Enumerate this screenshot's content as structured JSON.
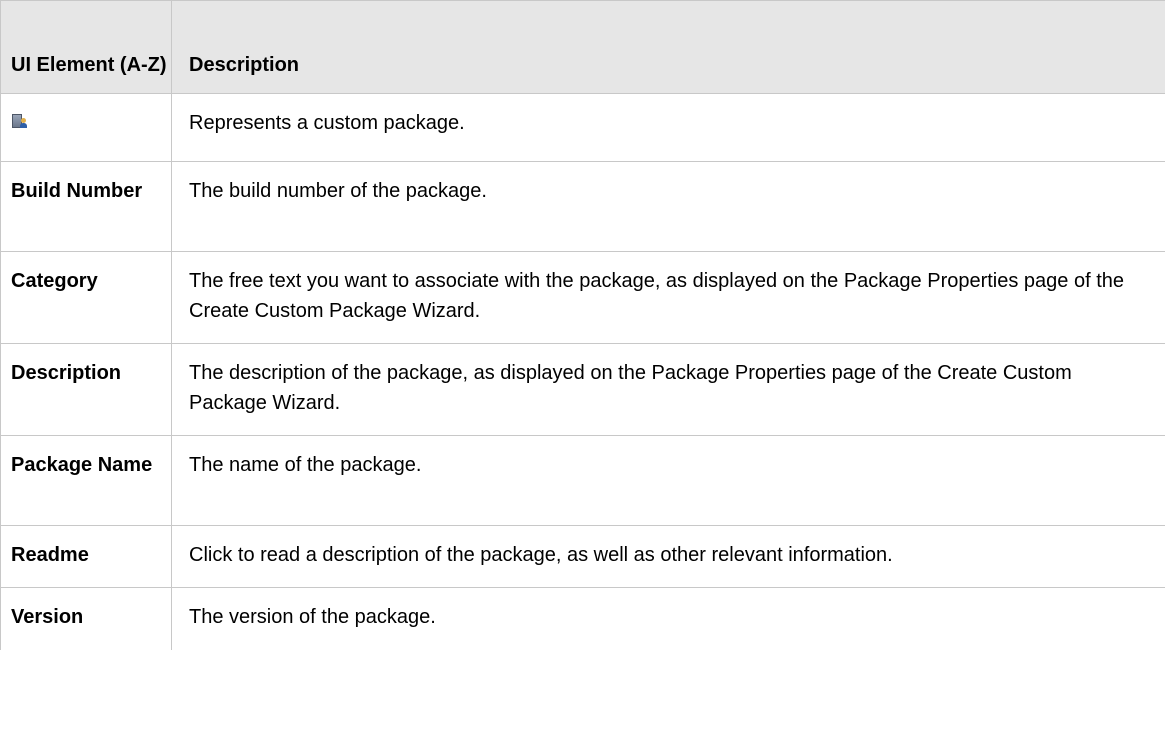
{
  "table": {
    "headers": {
      "element": "UI Element (A-Z)",
      "description": "Description"
    },
    "rows": [
      {
        "element": "",
        "icon": "custom-package-icon",
        "description": "Represents a custom package."
      },
      {
        "element": "Build Number",
        "description": "The build number of the package."
      },
      {
        "element": "Category",
        "description": "The free text you want to associate with the package, as displayed on the Package Properties page of the Create Custom Package Wizard."
      },
      {
        "element": "Description",
        "description": "The description of the package, as displayed on the Package Properties page of the Create Custom Package Wizard."
      },
      {
        "element": "Package Name",
        "description": "The name of the package."
      },
      {
        "element": "Readme",
        "description": "Click to read a description of the package, as well as other relevant information."
      },
      {
        "element": "Version",
        "description": "The version of the package."
      }
    ]
  }
}
